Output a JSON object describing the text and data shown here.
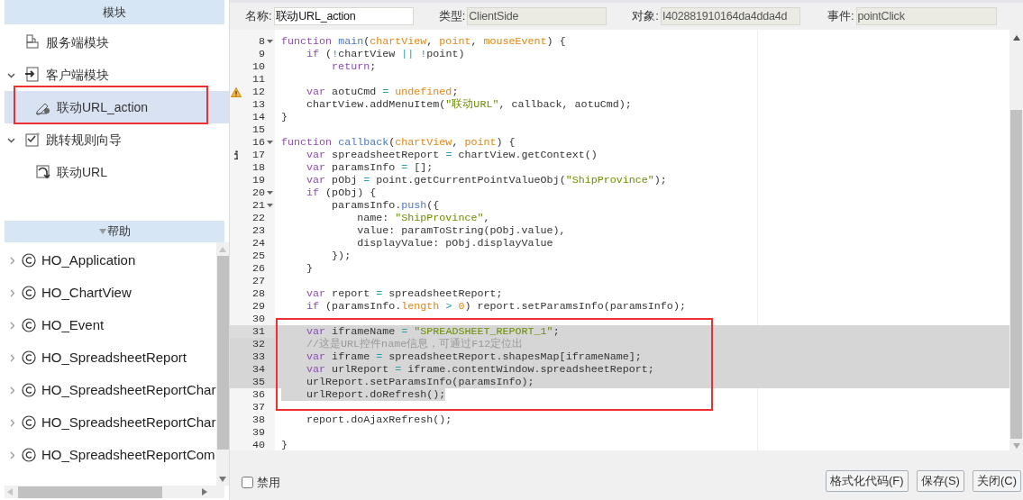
{
  "modules_panel": {
    "title": "模块",
    "items": [
      {
        "label": "服务端模块",
        "kind": "server",
        "selected": false
      },
      {
        "label": "客户端模块",
        "kind": "client",
        "selected": false,
        "expanded": true,
        "children": [
          {
            "label": "联动URL_action",
            "kind": "action",
            "selected": true
          }
        ]
      },
      {
        "label": "跳转规则向导",
        "kind": "wizard",
        "selected": false,
        "expanded": true,
        "children": [
          {
            "label": "联动URL",
            "kind": "link",
            "selected": false
          }
        ]
      }
    ]
  },
  "help_panel": {
    "title": "帮助",
    "items": [
      {
        "label": "HO_Application",
        "expanded": false
      },
      {
        "label": "HO_ChartView",
        "expanded": false
      },
      {
        "label": "HO_Event",
        "expanded": false
      },
      {
        "label": "HO_SpreadsheetReport",
        "expanded": false
      },
      {
        "label": "HO_SpreadsheetReportChar",
        "expanded": false
      },
      {
        "label": "HO_SpreadsheetReportChar",
        "expanded": false
      },
      {
        "label": "HO_SpreadsheetReportCom",
        "expanded": false
      }
    ]
  },
  "properties": [
    {
      "label": "名称:",
      "value": "联动URL_action",
      "readonly": false
    },
    {
      "label": "类型:",
      "value": "ClientSide",
      "readonly": true
    },
    {
      "label": "对象:",
      "value": "I402881910164da4dda4d",
      "readonly": true
    },
    {
      "label": "事件:",
      "value": "pointClick",
      "readonly": true
    }
  ],
  "code_lines": [
    {
      "number": "8",
      "fold": true,
      "selected": false,
      "tokens": [
        {
          "text": "function ",
          "kind": "keyword"
        },
        {
          "text": "main",
          "kind": "function"
        },
        {
          "text": "(",
          "kind": "plain"
        },
        {
          "text": "chartView",
          "kind": "param"
        },
        {
          "text": ", ",
          "kind": "plain"
        },
        {
          "text": "point",
          "kind": "param"
        },
        {
          "text": ", ",
          "kind": "plain"
        },
        {
          "text": "mouseEvent",
          "kind": "param"
        },
        {
          "text": ") {",
          "kind": "plain"
        }
      ]
    },
    {
      "number": "9",
      "selected": false,
      "tokens": [
        {
          "text": "    if",
          "kind": "keyword"
        },
        {
          "text": " (",
          "kind": "plain"
        },
        {
          "text": "!",
          "kind": "operator"
        },
        {
          "text": "chartView ",
          "kind": "plain"
        },
        {
          "text": "|| !",
          "kind": "operator"
        },
        {
          "text": "point)",
          "kind": "plain"
        }
      ]
    },
    {
      "number": "10",
      "selected": false,
      "tokens": [
        {
          "text": "        return",
          "kind": "keyword"
        },
        {
          "text": ";",
          "kind": "plain"
        }
      ]
    },
    {
      "number": "11",
      "selected": false
    },
    {
      "number": "12",
      "marker": {
        "kind": "warning"
      },
      "selected": false,
      "tokens": [
        {
          "text": "    var",
          "kind": "keyword"
        },
        {
          "text": " aotuCmd ",
          "kind": "plain"
        },
        {
          "text": "= ",
          "kind": "operator"
        },
        {
          "text": "undefined",
          "kind": "param"
        },
        {
          "text": ";",
          "kind": "plain"
        }
      ]
    },
    {
      "number": "13",
      "selected": false,
      "tokens": [
        {
          "text": "    chartView.addMenuItem(",
          "kind": "plain"
        },
        {
          "text": "\"联动URL\"",
          "kind": "string"
        },
        {
          "text": ", callback, aotuCmd);",
          "kind": "plain"
        }
      ]
    },
    {
      "number": "14",
      "selected": false,
      "tokens": [
        {
          "text": "}",
          "kind": "plain"
        }
      ]
    },
    {
      "number": "15",
      "selected": false
    },
    {
      "number": "16",
      "fold": true,
      "selected": false,
      "tokens": [
        {
          "text": "function ",
          "kind": "keyword"
        },
        {
          "text": "callback",
          "kind": "function"
        },
        {
          "text": "(",
          "kind": "plain"
        },
        {
          "text": "chartView",
          "kind": "param"
        },
        {
          "text": ", ",
          "kind": "plain"
        },
        {
          "text": "point",
          "kind": "param"
        },
        {
          "text": ") {",
          "kind": "plain"
        }
      ]
    },
    {
      "number": "17",
      "marker": {
        "kind": "info"
      },
      "selected": false,
      "tokens": [
        {
          "text": "    var",
          "kind": "keyword"
        },
        {
          "text": " spreadsheetReport ",
          "kind": "plain"
        },
        {
          "text": "=",
          "kind": "operator"
        },
        {
          "text": " chartView.getContext()",
          "kind": "plain"
        }
      ]
    },
    {
      "number": "18",
      "selected": false,
      "tokens": [
        {
          "text": "    var",
          "kind": "keyword"
        },
        {
          "text": " paramsInfo ",
          "kind": "plain"
        },
        {
          "text": "=",
          "kind": "operator"
        },
        {
          "text": " [];",
          "kind": "plain"
        }
      ]
    },
    {
      "number": "19",
      "selected": false,
      "tokens": [
        {
          "text": "    var",
          "kind": "keyword"
        },
        {
          "text": " pObj ",
          "kind": "plain"
        },
        {
          "text": "=",
          "kind": "operator"
        },
        {
          "text": " point.getCurrentPointValueObj(",
          "kind": "plain"
        },
        {
          "text": "\"ShipProvince\"",
          "kind": "string"
        },
        {
          "text": ");",
          "kind": "plain"
        }
      ]
    },
    {
      "number": "20",
      "fold": true,
      "selected": false,
      "tokens": [
        {
          "text": "    if",
          "kind": "keyword"
        },
        {
          "text": " (pObj) {",
          "kind": "plain"
        }
      ]
    },
    {
      "number": "21",
      "fold": true,
      "selected": false,
      "tokens": [
        {
          "text": "        paramsInfo.",
          "kind": "plain"
        },
        {
          "text": "push",
          "kind": "function"
        },
        {
          "text": "({",
          "kind": "plain"
        }
      ]
    },
    {
      "number": "22",
      "selected": false,
      "tokens": [
        {
          "text": "            name: ",
          "kind": "plain"
        },
        {
          "text": "\"ShipProvince\"",
          "kind": "string"
        },
        {
          "text": ",",
          "kind": "plain"
        }
      ]
    },
    {
      "number": "23",
      "selected": false,
      "tokens": [
        {
          "text": "            value: paramToString(pObj.value),",
          "kind": "plain"
        }
      ]
    },
    {
      "number": "24",
      "selected": false,
      "tokens": [
        {
          "text": "            displayValue: pObj.displayValue",
          "kind": "plain"
        }
      ]
    },
    {
      "number": "25",
      "selected": false,
      "tokens": [
        {
          "text": "        });",
          "kind": "plain"
        }
      ]
    },
    {
      "number": "26",
      "selected": false,
      "tokens": [
        {
          "text": "    }",
          "kind": "plain"
        }
      ]
    },
    {
      "number": "27",
      "selected": false
    },
    {
      "number": "28",
      "selected": false,
      "tokens": [
        {
          "text": "    var",
          "kind": "keyword"
        },
        {
          "text": " report ",
          "kind": "plain"
        },
        {
          "text": "=",
          "kind": "operator"
        },
        {
          "text": " spreadsheetReport;",
          "kind": "plain"
        }
      ]
    },
    {
      "number": "29",
      "selected": false,
      "tokens": [
        {
          "text": "    if",
          "kind": "keyword"
        },
        {
          "text": " (paramsInfo.",
          "kind": "plain"
        },
        {
          "text": "length",
          "kind": "param"
        },
        {
          "text": " > ",
          "kind": "operator"
        },
        {
          "text": "0",
          "kind": "param"
        },
        {
          "text": ") report.setParamsInfo(paramsInfo);",
          "kind": "plain"
        }
      ]
    },
    {
      "number": "30",
      "selected": false
    },
    {
      "number": "31",
      "active": true,
      "selected": true,
      "tokens": [
        {
          "text": "    var",
          "kind": "keyword"
        },
        {
          "text": " iframeName ",
          "kind": "plain"
        },
        {
          "text": "= ",
          "kind": "operator"
        },
        {
          "text": "\"SPREADSHEET_REPORT_1\"",
          "kind": "string"
        },
        {
          "text": ";",
          "kind": "plain"
        }
      ]
    },
    {
      "number": "32",
      "selected": true,
      "tokens": [
        {
          "text": "    //这是URL控件name信息，可通过F12定位出",
          "kind": "comment"
        }
      ]
    },
    {
      "number": "33",
      "selected": true,
      "tokens": [
        {
          "text": "    var",
          "kind": "keyword"
        },
        {
          "text": " iframe ",
          "kind": "plain"
        },
        {
          "text": "=",
          "kind": "operator"
        },
        {
          "text": " spreadsheetReport.shapesMap[iframeName];",
          "kind": "plain"
        }
      ]
    },
    {
      "number": "34",
      "selected": true,
      "tokens": [
        {
          "text": "    var",
          "kind": "keyword"
        },
        {
          "text": " urlReport ",
          "kind": "plain"
        },
        {
          "text": "=",
          "kind": "operator"
        },
        {
          "text": " iframe.contentWindow.spreadsheetReport;",
          "kind": "plain"
        }
      ]
    },
    {
      "number": "35",
      "selected": true,
      "tokens": [
        {
          "text": "    urlReport.setParamsInfo(paramsInfo);",
          "kind": "plain"
        }
      ]
    },
    {
      "number": "36",
      "selected": true,
      "tokens": [
        {
          "text": "    urlReport.doRefresh();",
          "kind": "plain"
        }
      ]
    },
    {
      "number": "37",
      "selected": false
    },
    {
      "number": "38",
      "selected": false,
      "tokens": [
        {
          "text": "    report.doAjaxRefresh();",
          "kind": "plain"
        }
      ]
    },
    {
      "number": "39",
      "selected": false
    },
    {
      "number": "40",
      "selected": false,
      "tokens": [
        {
          "text": "}",
          "kind": "plain"
        }
      ]
    }
  ],
  "disabled_checkbox": {
    "label": "禁用",
    "checked": false
  },
  "buttons": [
    "格式化代码(F)",
    "保存(S)",
    "关闭(C)"
  ]
}
